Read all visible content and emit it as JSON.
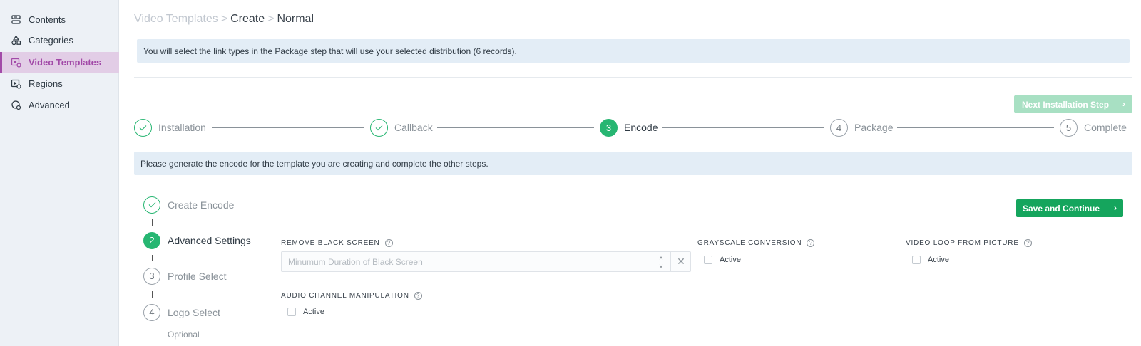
{
  "sidebar": {
    "items": [
      {
        "label": "Contents",
        "icon": "contents-icon",
        "active": false
      },
      {
        "label": "Categories",
        "icon": "categories-icon",
        "active": false
      },
      {
        "label": "Video Templates",
        "icon": "video-templates-icon",
        "active": true
      },
      {
        "label": "Regions",
        "icon": "regions-icon",
        "active": false
      },
      {
        "label": "Advanced",
        "icon": "advanced-icon",
        "active": false
      }
    ]
  },
  "breadcrumb": {
    "items": [
      "Video Templates",
      "Create",
      "Normal"
    ],
    "separator": ">"
  },
  "info_top": "You will select the link types in the Package step that will use your selected distribution (6 records).",
  "next_button": {
    "label": "Next Installation Step",
    "icon": "chevron-right-icon"
  },
  "steps": [
    {
      "number": "",
      "label": "Installation",
      "status": "done"
    },
    {
      "number": "",
      "label": "Callback",
      "status": "done"
    },
    {
      "number": "3",
      "label": "Encode",
      "status": "current"
    },
    {
      "number": "4",
      "label": "Package",
      "status": "todo"
    },
    {
      "number": "5",
      "label": "Complete",
      "status": "todo"
    }
  ],
  "info_mid": "Please generate the encode for the template you are creating and complete the other steps.",
  "substeps": [
    {
      "number": "",
      "label": "Create Encode",
      "status": "done"
    },
    {
      "number": "2",
      "label": "Advanced Settings",
      "status": "current"
    },
    {
      "number": "3",
      "label": "Profile Select",
      "status": "todo"
    },
    {
      "number": "4",
      "label": "Logo Select",
      "status": "todo"
    }
  ],
  "optional_label": "Optional",
  "save_button": {
    "label": "Save and Continue",
    "icon": "chevron-right-icon"
  },
  "form": {
    "remove_black_screen": {
      "label": "REMOVE BLACK SCREEN",
      "value": "",
      "placeholder": "Minumum Duration of Black Screen"
    },
    "grayscale_conversion": {
      "label": "GRAYSCALE CONVERSION",
      "checkbox_label": "Active",
      "checked": false
    },
    "video_loop_from_picture": {
      "label": "VIDEO LOOP FROM PICTURE",
      "checkbox_label": "Active",
      "checked": false
    },
    "audio_channel_manipulation": {
      "label": "AUDIO CHANNEL MANIPULATION",
      "checkbox_label": "Active",
      "checked": false
    },
    "help_icon": "help-icon"
  },
  "colors": {
    "accent_purple": "#a24aa8",
    "active_nav_bg": "#e2cde6",
    "success_green": "#27b672",
    "button_green": "#15a55d",
    "disabled_green": "#a8e0c3",
    "info_bg": "#e3edf6",
    "sidebar_bg": "#edf1f6"
  }
}
